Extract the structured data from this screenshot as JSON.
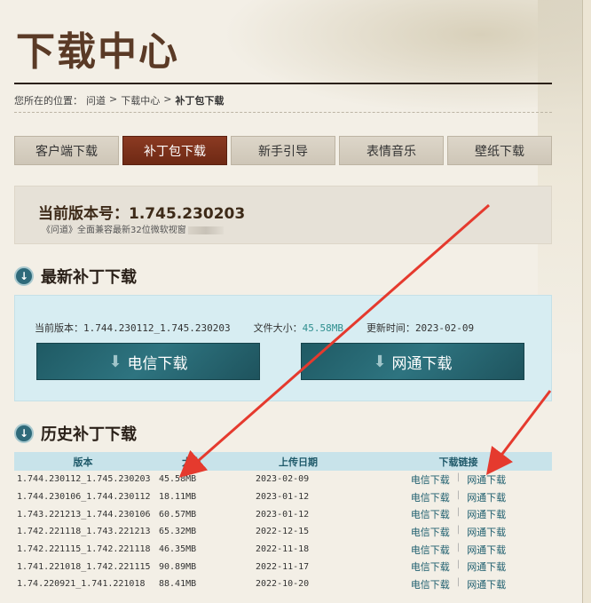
{
  "page": {
    "title": "下载中心",
    "breadcrumb": [
      "您所在的位置：",
      "问道",
      ">",
      "下载中心",
      ">",
      "补丁包下载"
    ]
  },
  "tabs": [
    {
      "label": "客户端下载"
    },
    {
      "label": "补丁包下载",
      "active": true
    },
    {
      "label": "新手引导"
    },
    {
      "label": "表情音乐"
    },
    {
      "label": "壁纸下载"
    }
  ],
  "version": {
    "title": "当前版本号：1.745.230203",
    "note": "《问道》全面兼容最新32位微软视窗"
  },
  "latest": {
    "heading": "最新补丁下载",
    "current_label": "当前版本：",
    "current_value": "1.744.230112_1.745.230203",
    "size_label": "文件大小：",
    "size_value": "45.58MB",
    "time_label": "更新时间：",
    "time_value": "2023-02-09",
    "btn_telecom": "电信下载",
    "btn_netcom": "网通下载"
  },
  "history": {
    "heading": "历史补丁下载",
    "columns": [
      "版本",
      "大小",
      "上传日期",
      "下载链接"
    ],
    "link_telecom": "电信下载",
    "link_sep": "|",
    "link_netcom": "网通下载",
    "rows": [
      {
        "version": "1.744.230112_1.745.230203",
        "size": "45.58MB",
        "date": "2023-02-09"
      },
      {
        "version": "1.744.230106_1.744.230112",
        "size": "18.11MB",
        "date": "2023-01-12"
      },
      {
        "version": "1.743.221213_1.744.230106",
        "size": "60.57MB",
        "date": "2023-01-12"
      },
      {
        "version": "1.742.221118_1.743.221213",
        "size": "65.32MB",
        "date": "2022-12-15"
      },
      {
        "version": "1.742.221115_1.742.221118",
        "size": "46.35MB",
        "date": "2022-11-18"
      },
      {
        "version": "1.741.221018_1.742.221115",
        "size": "90.89MB",
        "date": "2022-11-17"
      },
      {
        "version": "1.74.220921_1.741.221018",
        "size": "88.41MB",
        "date": "2022-10-20"
      }
    ]
  },
  "colors": {
    "brand_red": "#6e2914",
    "teal": "#1f5a64",
    "annotation_arrow": "#e53a2e"
  }
}
